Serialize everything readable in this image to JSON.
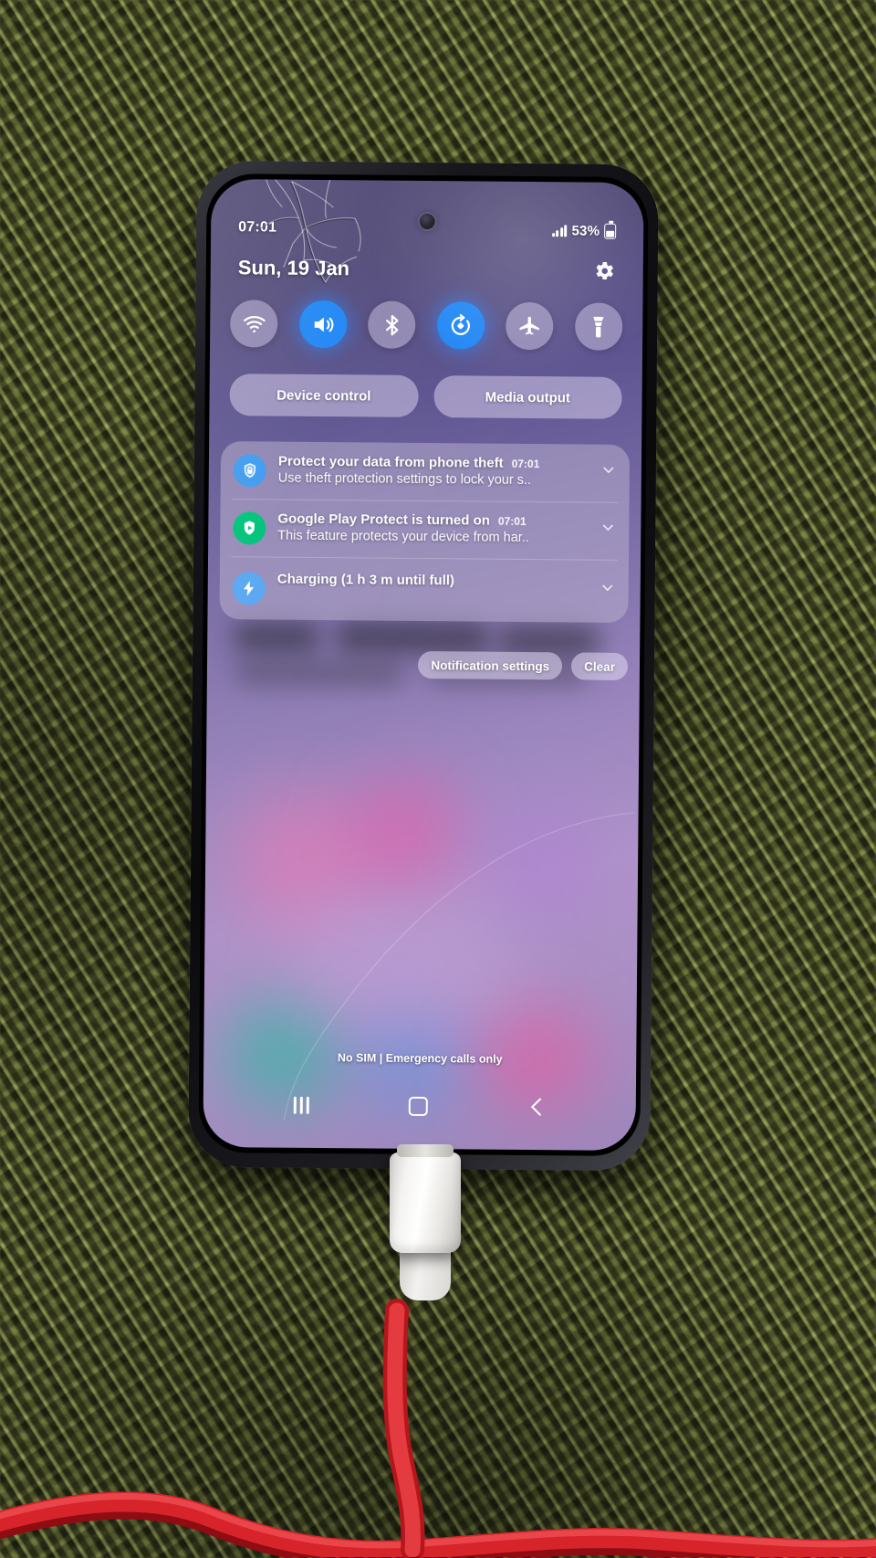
{
  "device": {
    "description": "smartphone-quick-settings-panel",
    "accent_blue": "#1f86f5",
    "panel_tint": "rgba(186,176,208,0.52)"
  },
  "statusbar": {
    "time": "07:01",
    "signal_icon": "signal-bars-icon",
    "battery_percent": "53%",
    "battery_icon": "battery-charging-icon"
  },
  "header": {
    "date": "Sun, 19 Jan",
    "settings_icon": "gear-icon"
  },
  "quick_toggles": [
    {
      "name": "wifi",
      "icon": "wifi-icon",
      "label": "Wi-Fi",
      "state": "off"
    },
    {
      "name": "sound",
      "icon": "speaker-icon",
      "label": "Sound",
      "state": "on"
    },
    {
      "name": "bluetooth",
      "icon": "bluetooth-icon",
      "label": "Bluetooth",
      "state": "off"
    },
    {
      "name": "auto-rotate",
      "icon": "auto-rotate-icon",
      "label": "Auto rotate",
      "state": "on"
    },
    {
      "name": "airplane",
      "icon": "airplane-icon",
      "label": "Flight mode",
      "state": "off"
    },
    {
      "name": "flashlight",
      "icon": "flashlight-icon",
      "label": "Flashlight",
      "state": "off"
    }
  ],
  "pill_buttons": [
    {
      "label": "Device control"
    },
    {
      "label": "Media output"
    }
  ],
  "notifications": [
    {
      "icon": "shield-lock-icon",
      "icon_bg": "#3f9bf0",
      "title": "Protect your data from phone theft",
      "time": "07:01",
      "text": "Use theft protection settings to lock your s..",
      "expand_icon": "chevron-down-icon"
    },
    {
      "icon": "play-protect-shield-icon",
      "icon_bg": "#00c37a",
      "title": "Google Play Protect is turned on",
      "time": "07:01",
      "text": "This feature protects your device from har..",
      "expand_icon": "chevron-down-icon"
    },
    {
      "icon": "charging-bolt-icon",
      "icon_bg": "#5aa7f2",
      "title": "Charging (1 h 3 m until full)",
      "time": "",
      "text": "",
      "expand_icon": "chevron-down-icon"
    }
  ],
  "notification_actions": {
    "settings_label": "Notification settings",
    "clear_label": "Clear"
  },
  "footer": {
    "sim_status": "No SIM | Emergency calls only"
  },
  "navbar": {
    "recents_icon": "recents-icon",
    "home_icon": "home-icon",
    "back_icon": "back-icon"
  }
}
